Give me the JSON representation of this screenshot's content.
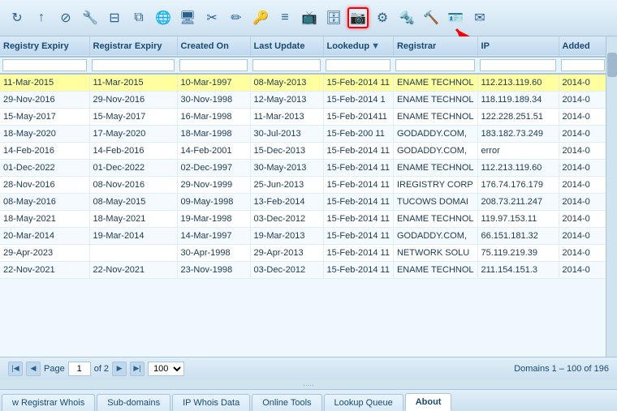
{
  "toolbar": {
    "icons": [
      {
        "name": "refresh-icon",
        "symbol": "↻"
      },
      {
        "name": "up-icon",
        "symbol": "↑"
      },
      {
        "name": "stop-icon",
        "symbol": "⊘"
      },
      {
        "name": "tools-icon",
        "symbol": "🔧"
      },
      {
        "name": "window-icon",
        "symbol": "⊟"
      },
      {
        "name": "copy-icon",
        "symbol": "⧉"
      },
      {
        "name": "globe-icon",
        "symbol": "🌐"
      },
      {
        "name": "monitor-icon",
        "symbol": "🖥"
      },
      {
        "name": "scissors-icon",
        "symbol": "✂"
      },
      {
        "name": "edit-icon",
        "symbol": "✏"
      },
      {
        "name": "key-icon",
        "symbol": "🔑"
      },
      {
        "name": "list-icon",
        "symbol": "≡"
      },
      {
        "name": "screen-icon",
        "symbol": "📺"
      },
      {
        "name": "db-icon",
        "symbol": "🗄"
      },
      {
        "name": "camera-icon",
        "symbol": "📷",
        "highlighted": true
      },
      {
        "name": "settings-icon",
        "symbol": "⚙"
      },
      {
        "name": "gear2-icon",
        "symbol": "🔩"
      },
      {
        "name": "wrench-icon",
        "symbol": "🔨"
      },
      {
        "name": "card-icon",
        "symbol": "🪪"
      },
      {
        "name": "email-icon",
        "symbol": "✉"
      }
    ]
  },
  "table": {
    "columns": [
      {
        "key": "registry_expiry",
        "label": "Registry Expiry",
        "width": "110"
      },
      {
        "key": "registrar_expiry",
        "label": "Registrar Expiry",
        "width": "108"
      },
      {
        "key": "created_on",
        "label": "Created On",
        "width": "90"
      },
      {
        "key": "last_update",
        "label": "Last Update",
        "width": "90"
      },
      {
        "key": "lookedup",
        "label": "Lookedup",
        "width": "85",
        "sortable": true
      },
      {
        "key": "registrar",
        "label": "Registrar",
        "width": "95"
      },
      {
        "key": "ip",
        "label": "IP",
        "width": "100"
      },
      {
        "key": "added",
        "label": "Added",
        "width": "60"
      }
    ],
    "rows": [
      {
        "registry_expiry": "11-Mar-2015",
        "registrar_expiry": "11-Mar-2015",
        "created_on": "10-Mar-1997",
        "last_update": "08-May-2013",
        "lookedup": "15-Feb-2014 11",
        "registrar": "ENAME TECHNOL",
        "ip": "112.213.119.60",
        "added": "2014-0",
        "highlight": true
      },
      {
        "registry_expiry": "29-Nov-2016",
        "registrar_expiry": "29-Nov-2016",
        "created_on": "30-Nov-1998",
        "last_update": "12-May-2013",
        "lookedup": "15-Feb-2014 1",
        "registrar": "ENAME TECHNOL",
        "ip": "118.119.189.34",
        "added": "2014-0"
      },
      {
        "registry_expiry": "15-May-2017",
        "registrar_expiry": "15-May-2017",
        "created_on": "16-Mar-1998",
        "last_update": "11-Mar-2013",
        "lookedup": "15-Feb-201411",
        "registrar": "ENAME TECHNOL",
        "ip": "122.228.251.51",
        "added": "2014-0"
      },
      {
        "registry_expiry": "18-May-2020",
        "registrar_expiry": "17-May-2020",
        "created_on": "18-Mar-1998",
        "last_update": "30-Jul-2013",
        "lookedup": "15-Feb-200 11",
        "registrar": "GODADDY.COM,",
        "ip": "183.182.73.249",
        "added": "2014-0"
      },
      {
        "registry_expiry": "14-Feb-2016",
        "registrar_expiry": "14-Feb-2016",
        "created_on": "14-Feb-2001",
        "last_update": "15-Dec-2013",
        "lookedup": "15-Feb-2014 11",
        "registrar": "GODADDY.COM,",
        "ip": "error",
        "added": "2014-0"
      },
      {
        "registry_expiry": "01-Dec-2022",
        "registrar_expiry": "01-Dec-2022",
        "created_on": "02-Dec-1997",
        "last_update": "30-May-2013",
        "lookedup": "15-Feb-2014 11",
        "registrar": "ENAME TECHNOL",
        "ip": "112.213.119.60",
        "added": "2014-0"
      },
      {
        "registry_expiry": "28-Nov-2016",
        "registrar_expiry": "08-Nov-2016",
        "created_on": "29-Nov-1999",
        "last_update": "25-Jun-2013",
        "lookedup": "15-Feb-2014 11",
        "registrar": "IREGISTRY CORP",
        "ip": "176.74.176.179",
        "added": "2014-0"
      },
      {
        "registry_expiry": "08-May-2016",
        "registrar_expiry": "08-May-2015",
        "created_on": "09-May-1998",
        "last_update": "13-Feb-2014",
        "lookedup": "15-Feb-2014 11",
        "registrar": "TUCOWS DOMAI",
        "ip": "208.73.211.247",
        "added": "2014-0"
      },
      {
        "registry_expiry": "18-May-2021",
        "registrar_expiry": "18-May-2021",
        "created_on": "19-Mar-1998",
        "last_update": "03-Dec-2012",
        "lookedup": "15-Feb-2014 11",
        "registrar": "ENAME TECHNOL",
        "ip": "119.97.153.11",
        "added": "2014-0"
      },
      {
        "registry_expiry": "20-Mar-2014",
        "registrar_expiry": "19-Mar-2014",
        "created_on": "14-Mar-1997",
        "last_update": "19-Mar-2013",
        "lookedup": "15-Feb-2014 11",
        "registrar": "GODADDY.COM,",
        "ip": "66.151.181.32",
        "added": "2014-0"
      },
      {
        "registry_expiry": "29-Apr-2023",
        "registrar_expiry": "",
        "created_on": "30-Apr-1998",
        "last_update": "29-Apr-2013",
        "lookedup": "15-Feb-2014 11",
        "registrar": "NETWORK SOLU",
        "ip": "75.119.219.39",
        "added": "2014-0"
      },
      {
        "registry_expiry": "22-Nov-2021",
        "registrar_expiry": "22-Nov-2021",
        "created_on": "23-Nov-1998",
        "last_update": "03-Dec-2012",
        "lookedup": "15-Feb-2014 11",
        "registrar": "ENAME TECHNOL",
        "ip": "211.154.151.3",
        "added": "2014-0"
      }
    ]
  },
  "pagination": {
    "page_label": "Page",
    "current_page": "1",
    "of_label": "of 2",
    "page_size": "100",
    "summary": "Domains 1 – 100 of 196"
  },
  "tabs": [
    {
      "key": "new-registrar-whois",
      "label": "w Registrar Whois"
    },
    {
      "key": "sub-domains",
      "label": "Sub-domains"
    },
    {
      "key": "ip-whois-data",
      "label": "IP Whois Data"
    },
    {
      "key": "online-tools",
      "label": "Online Tools"
    },
    {
      "key": "lookup-queue",
      "label": "Lookup Queue"
    },
    {
      "key": "about",
      "label": "About",
      "active": true
    }
  ],
  "dots": "....."
}
